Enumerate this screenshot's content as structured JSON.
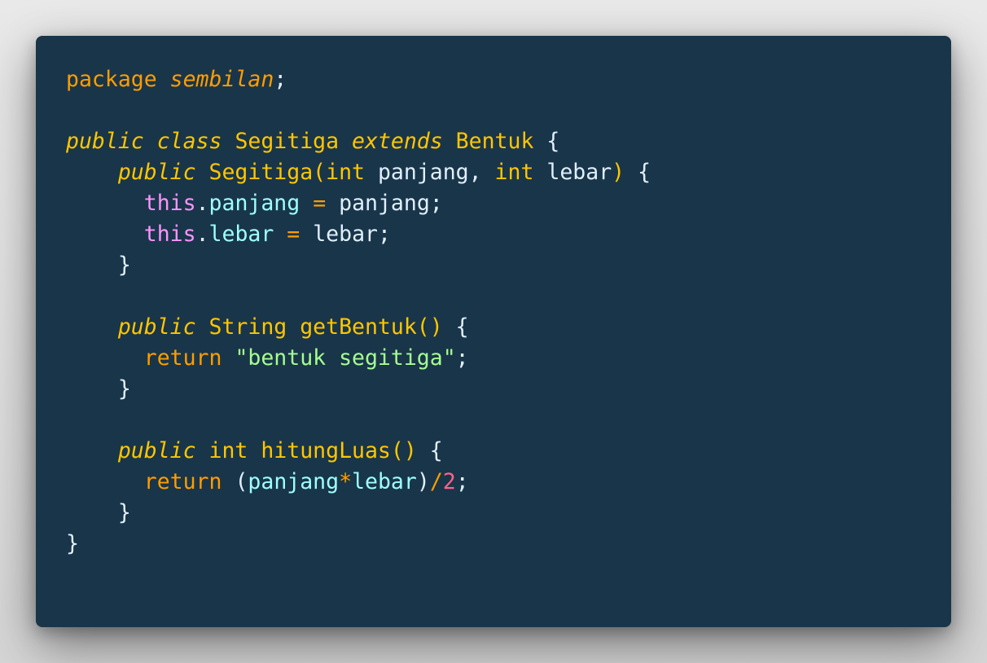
{
  "code": {
    "language": "java",
    "lines": [
      [
        {
          "t": "package ",
          "c": "t-kw"
        },
        {
          "t": "sembilan",
          "c": "t-kw i"
        },
        {
          "t": ";",
          "c": "t-plain"
        }
      ],
      [],
      [
        {
          "t": "public",
          "c": "t-mod"
        },
        {
          "t": " ",
          "c": "t-plain"
        },
        {
          "t": "class",
          "c": "t-mod"
        },
        {
          "t": " Segitiga ",
          "c": "t-type"
        },
        {
          "t": "extends",
          "c": "t-mod"
        },
        {
          "t": " Bentuk ",
          "c": "t-type"
        },
        {
          "t": "{",
          "c": "t-plain"
        }
      ],
      [
        {
          "t": "    ",
          "c": "t-plain"
        },
        {
          "t": "public",
          "c": "t-mod"
        },
        {
          "t": " Segitiga",
          "c": "t-fn"
        },
        {
          "t": "(",
          "c": "t-brace"
        },
        {
          "t": "int",
          "c": "t-type"
        },
        {
          "t": " panjang, ",
          "c": "t-plain"
        },
        {
          "t": "int",
          "c": "t-type"
        },
        {
          "t": " lebar",
          "c": "t-plain"
        },
        {
          "t": ")",
          "c": "t-brace"
        },
        {
          "t": " {",
          "c": "t-plain"
        }
      ],
      [
        {
          "t": "      ",
          "c": "t-plain"
        },
        {
          "t": "this",
          "c": "t-this"
        },
        {
          "t": ".",
          "c": "t-plain"
        },
        {
          "t": "panjang",
          "c": "t-prop"
        },
        {
          "t": " ",
          "c": "t-plain"
        },
        {
          "t": "=",
          "c": "t-op"
        },
        {
          "t": " panjang;",
          "c": "t-plain"
        }
      ],
      [
        {
          "t": "      ",
          "c": "t-plain"
        },
        {
          "t": "this",
          "c": "t-this"
        },
        {
          "t": ".",
          "c": "t-plain"
        },
        {
          "t": "lebar",
          "c": "t-prop"
        },
        {
          "t": " ",
          "c": "t-plain"
        },
        {
          "t": "=",
          "c": "t-op"
        },
        {
          "t": " lebar;",
          "c": "t-plain"
        }
      ],
      [
        {
          "t": "    }",
          "c": "t-plain"
        }
      ],
      [],
      [
        {
          "t": "    ",
          "c": "t-plain"
        },
        {
          "t": "public",
          "c": "t-mod"
        },
        {
          "t": " String ",
          "c": "t-type"
        },
        {
          "t": "getBentuk",
          "c": "t-fn"
        },
        {
          "t": "()",
          "c": "t-brace"
        },
        {
          "t": " {",
          "c": "t-plain"
        }
      ],
      [
        {
          "t": "      ",
          "c": "t-plain"
        },
        {
          "t": "return",
          "c": "t-kw"
        },
        {
          "t": " ",
          "c": "t-plain"
        },
        {
          "t": "\"bentuk segitiga\"",
          "c": "t-str"
        },
        {
          "t": ";",
          "c": "t-plain"
        }
      ],
      [
        {
          "t": "    }",
          "c": "t-plain"
        }
      ],
      [],
      [
        {
          "t": "    ",
          "c": "t-plain"
        },
        {
          "t": "public",
          "c": "t-mod"
        },
        {
          "t": " int ",
          "c": "t-type"
        },
        {
          "t": "hitungLuas",
          "c": "t-fn"
        },
        {
          "t": "()",
          "c": "t-brace"
        },
        {
          "t": " {",
          "c": "t-plain"
        }
      ],
      [
        {
          "t": "      ",
          "c": "t-plain"
        },
        {
          "t": "return",
          "c": "t-kw"
        },
        {
          "t": " ",
          "c": "t-plain"
        },
        {
          "t": "(",
          "c": "t-plain"
        },
        {
          "t": "panjang",
          "c": "t-prop"
        },
        {
          "t": "*",
          "c": "t-op"
        },
        {
          "t": "lebar",
          "c": "t-prop"
        },
        {
          "t": ")",
          "c": "t-plain"
        },
        {
          "t": "/",
          "c": "t-op"
        },
        {
          "t": "2",
          "c": "t-num"
        },
        {
          "t": ";",
          "c": "t-plain"
        }
      ],
      [
        {
          "t": "    }",
          "c": "t-plain"
        }
      ],
      [
        {
          "t": "}",
          "c": "t-plain"
        }
      ]
    ]
  },
  "colors": {
    "background": "#193549",
    "keyword": "#ff9d00",
    "modifier": "#ffc600",
    "this": "#fb94ff",
    "property": "#9effff",
    "string": "#a5ff90",
    "number": "#ff628c",
    "plain": "#e1efff"
  }
}
